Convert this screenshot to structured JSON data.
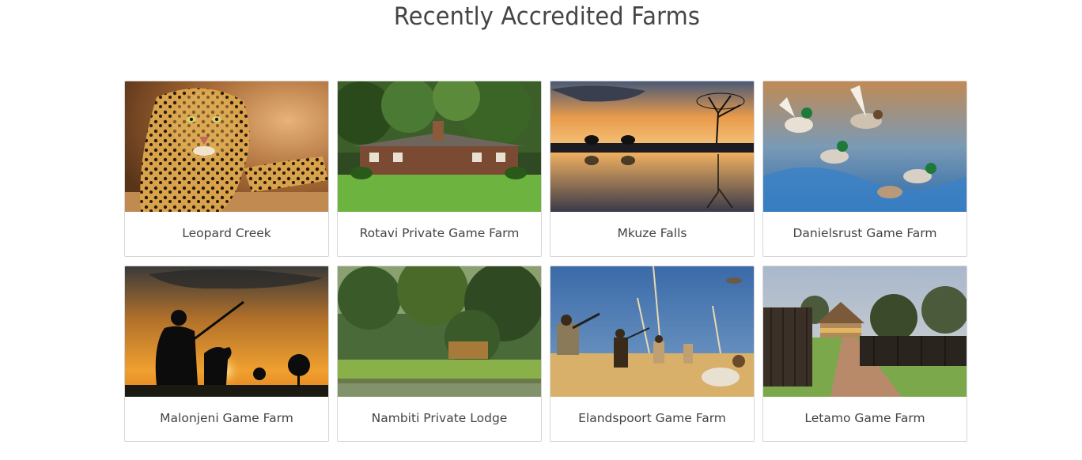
{
  "page": {
    "title": "Recently Accredited Farms"
  },
  "farms": [
    {
      "name": "Leopard Creek",
      "image": "leopard-photo"
    },
    {
      "name": "Rotavi Private Game Farm",
      "image": "lodge-house-photo"
    },
    {
      "name": "Mkuze Falls",
      "image": "sunset-elephants-photo"
    },
    {
      "name": "Danielsrust Game Farm",
      "image": "flying-ducks-photo"
    },
    {
      "name": "Malonjeni Game Farm",
      "image": "hunter-silhouette-photo"
    },
    {
      "name": "Nambiti Private Lodge",
      "image": "riverside-forest-photo"
    },
    {
      "name": "Elandspoort Game Farm",
      "image": "bird-hunters-photo"
    },
    {
      "name": "Letamo Game Farm",
      "image": "lodge-pathway-photo"
    }
  ]
}
